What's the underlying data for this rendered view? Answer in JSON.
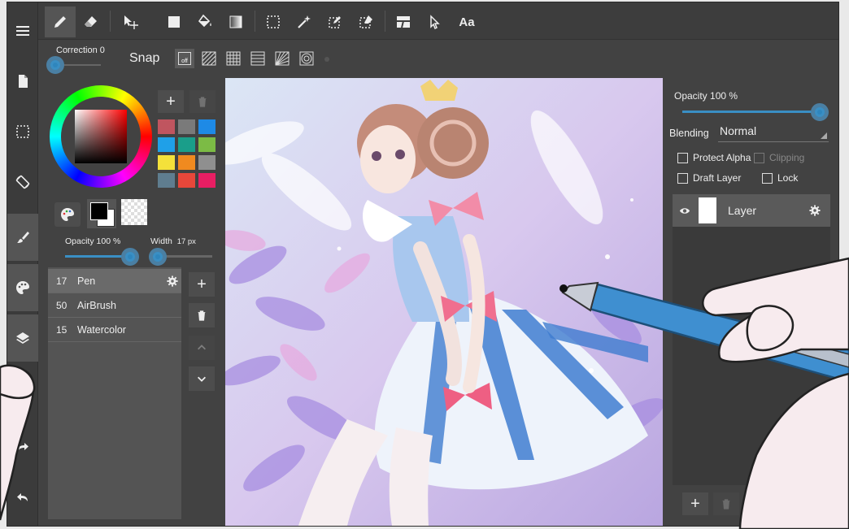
{
  "toolbar": {
    "tools": [
      "pen-icon",
      "eraser-icon",
      "move-icon",
      "fill-rect-icon",
      "bucket-icon",
      "gradient-icon",
      "select-rect-icon",
      "magic-wand-icon",
      "select-pen-icon",
      "select-eraser-icon",
      "mesh-transform-icon",
      "pointer-icon",
      "text-tool-icon"
    ],
    "text_tool_label": "Aa"
  },
  "snapbar": {
    "correction_label": "Correction 0",
    "snap_label": "Snap",
    "snap_off_label": "off"
  },
  "left_panel": {
    "swatches": [
      "#c0555f",
      "#7a7a7a",
      "#1e8ae6",
      "#1fa0e8",
      "#1a9e8a",
      "#7cbb45",
      "#f4e13a",
      "#f08a1f",
      "#8f8f8f",
      "#5f7d8f",
      "#e8473a",
      "#e81e63"
    ],
    "opacity_label": "Opacity 100 %",
    "width_label": "Width",
    "width_value": "17 px",
    "brushes": [
      {
        "size": "17",
        "name": "Pen"
      },
      {
        "size": "50",
        "name": "AirBrush"
      },
      {
        "size": "15",
        "name": "Watercolor"
      }
    ]
  },
  "right_panel": {
    "opacity_label": "Opacity 100 %",
    "blending_label": "Blending",
    "blending_value": "Normal",
    "protect_alpha": "Protect Alpha",
    "clipping": "Clipping",
    "draft_layer": "Draft Layer",
    "lock": "Lock",
    "layer_name": "Layer"
  },
  "colors": {
    "accent": "#3a8fc4",
    "panel": "#424242",
    "foreground": "#000000",
    "background": "#ffffff"
  }
}
